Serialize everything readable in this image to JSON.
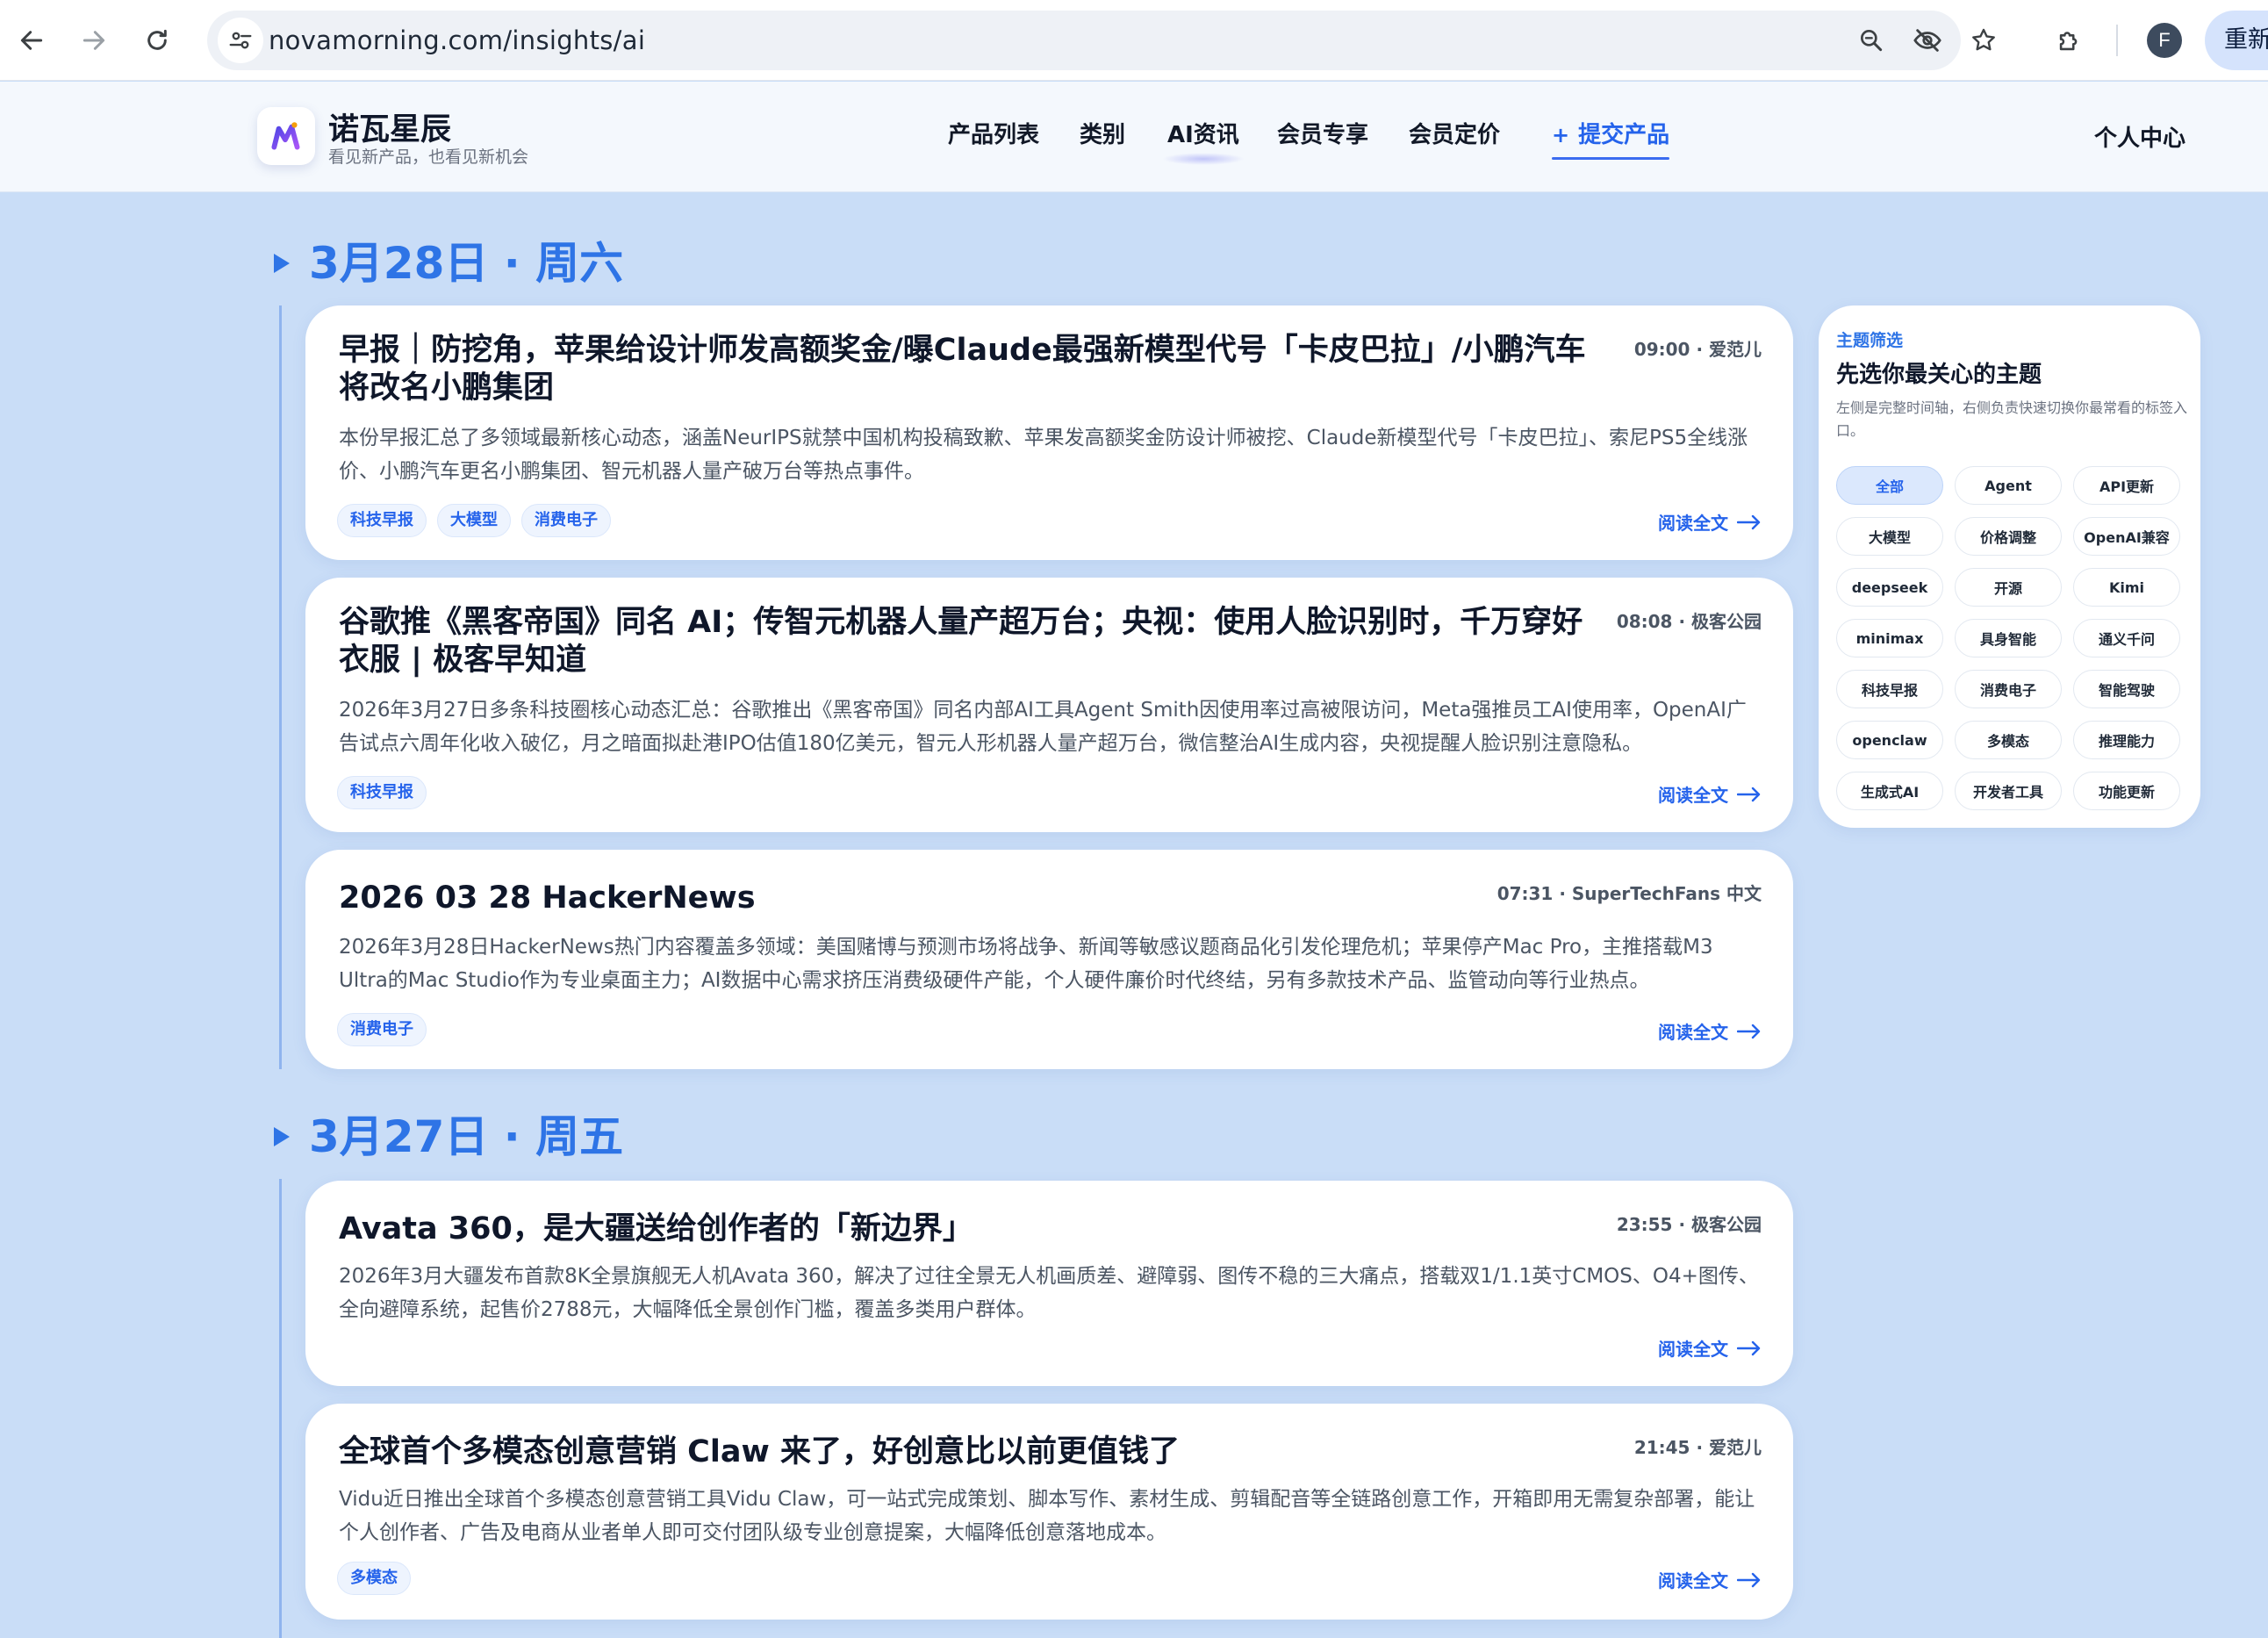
{
  "browser": {
    "url": "novamorning.com/insights/ai",
    "profile_initial": "F",
    "relaunch_label": "重新"
  },
  "site": {
    "brand_name": "诺瓦星辰",
    "brand_tagline": "看见新产品，也看见新机会",
    "nav": [
      "产品列表",
      "类别",
      "AI资讯",
      "会员专享",
      "会员定价"
    ],
    "submit_label": "提交产品",
    "user_center": "个人中心"
  },
  "timeline": [
    {
      "date": "3月28日 · 周六",
      "articles": [
        {
          "title": "早报｜防挖角，苹果给设计师发高额奖金/曝Claude最强新模型代号「卡皮巴拉」/小鹏汽车将改名小鹏集团",
          "meta": "09:00 · 爱范儿",
          "summary": "本份早报汇总了多领域最新核心动态，涵盖NeurIPS就禁中国机构投稿致歉、苹果发高额奖金防设计师被挖、Claude新模型代号「卡皮巴拉」、索尼PS5全线涨价、小鹏汽车更名小鹏集团、智元机器人量产破万台等热点事件。",
          "tags": [
            "科技早报",
            "大模型",
            "消费电子"
          ],
          "read_more": "阅读全文"
        },
        {
          "title": "谷歌推《黑客帝国》同名 AI；传智元机器人量产超万台；央视：使用人脸识别时，千万穿好衣服 | 极客早知道",
          "meta": "08:08 · 极客公园",
          "summary": "2026年3月27日多条科技圈核心动态汇总：谷歌推出《黑客帝国》同名内部AI工具Agent Smith因使用率过高被限访问，Meta强推员工AI使用率，OpenAI广告试点六周年化收入破亿，月之暗面拟赴港IPO估值180亿美元，智元人形机器人量产超万台，微信整治AI生成内容，央视提醒人脸识别注意隐私。",
          "tags": [
            "科技早报"
          ],
          "read_more": "阅读全文"
        },
        {
          "title": "2026 03 28 HackerNews",
          "meta": "07:31 · SuperTechFans 中文",
          "summary": "2026年3月28日HackerNews热门内容覆盖多领域：美国赌博与预测市场将战争、新闻等敏感议题商品化引发伦理危机；苹果停产Mac Pro，主推搭载M3 Ultra的Mac Studio作为专业桌面主力；AI数据中心需求挤压消费级硬件产能，个人硬件廉价时代终结，另有多款技术产品、监管动向等行业热点。",
          "tags": [
            "消费电子"
          ],
          "read_more": "阅读全文"
        }
      ]
    },
    {
      "date": "3月27日 · 周五",
      "articles": [
        {
          "title": "Avata 360，是大疆送给创作者的「新边界」",
          "meta": "23:55 · 极客公园",
          "summary": "2026年3月大疆发布首款8K全景旗舰无人机Avata 360，解决了过往全景无人机画质差、避障弱、图传不稳的三大痛点，搭载双1/1.1英寸CMOS、O4+图传、全向避障系统，起售价2788元，大幅降低全景创作门槛，覆盖多类用户群体。",
          "tags": [],
          "read_more": "阅读全文"
        },
        {
          "title": "全球首个多模态创意营销 Claw 来了，好创意比以前更值钱了",
          "meta": "21:45 · 爱范儿",
          "summary": "Vidu近日推出全球首个多模态创意营销工具Vidu Claw，可一站式完成策划、脚本写作、素材生成、剪辑配音等全链路创意工作，开箱即用无需复杂部署，能让个人创作者、广告及电商从业者单人即可交付团队级专业创意提案，大幅降低创意落地成本。",
          "tags": [
            "多模态"
          ],
          "read_more": "阅读全文"
        }
      ]
    }
  ],
  "topic_filter": {
    "eyebrow": "主题筛选",
    "title": "先选你最关心的主题",
    "description": "左侧是完整时间轴，右侧负责快速切换你最常看的标签入口。",
    "chips": [
      "全部",
      "Agent",
      "API更新",
      "大模型",
      "价格调整",
      "OpenAI兼容",
      "deepseek",
      "开源",
      "Kimi",
      "minimax",
      "具身智能",
      "通义千问",
      "科技早报",
      "消费电子",
      "智能驾驶",
      "openclaw",
      "多模态",
      "推理能力",
      "生成式AI",
      "开发者工具",
      "功能更新"
    ],
    "active_chip": "全部"
  },
  "icons": {
    "back": "arrow-left-icon",
    "forward": "arrow-right-icon",
    "reload": "reload-icon",
    "site_info": "tune-icon",
    "zoom": "zoom-icon",
    "tracking": "eye-off-icon",
    "bookmark": "star-icon",
    "extensions": "puzzle-icon",
    "read_more": "arrow-right-icon"
  },
  "colors": {
    "page_bg": "#c9ddf7",
    "accent": "#2e74e6",
    "link": "#2563eb"
  }
}
